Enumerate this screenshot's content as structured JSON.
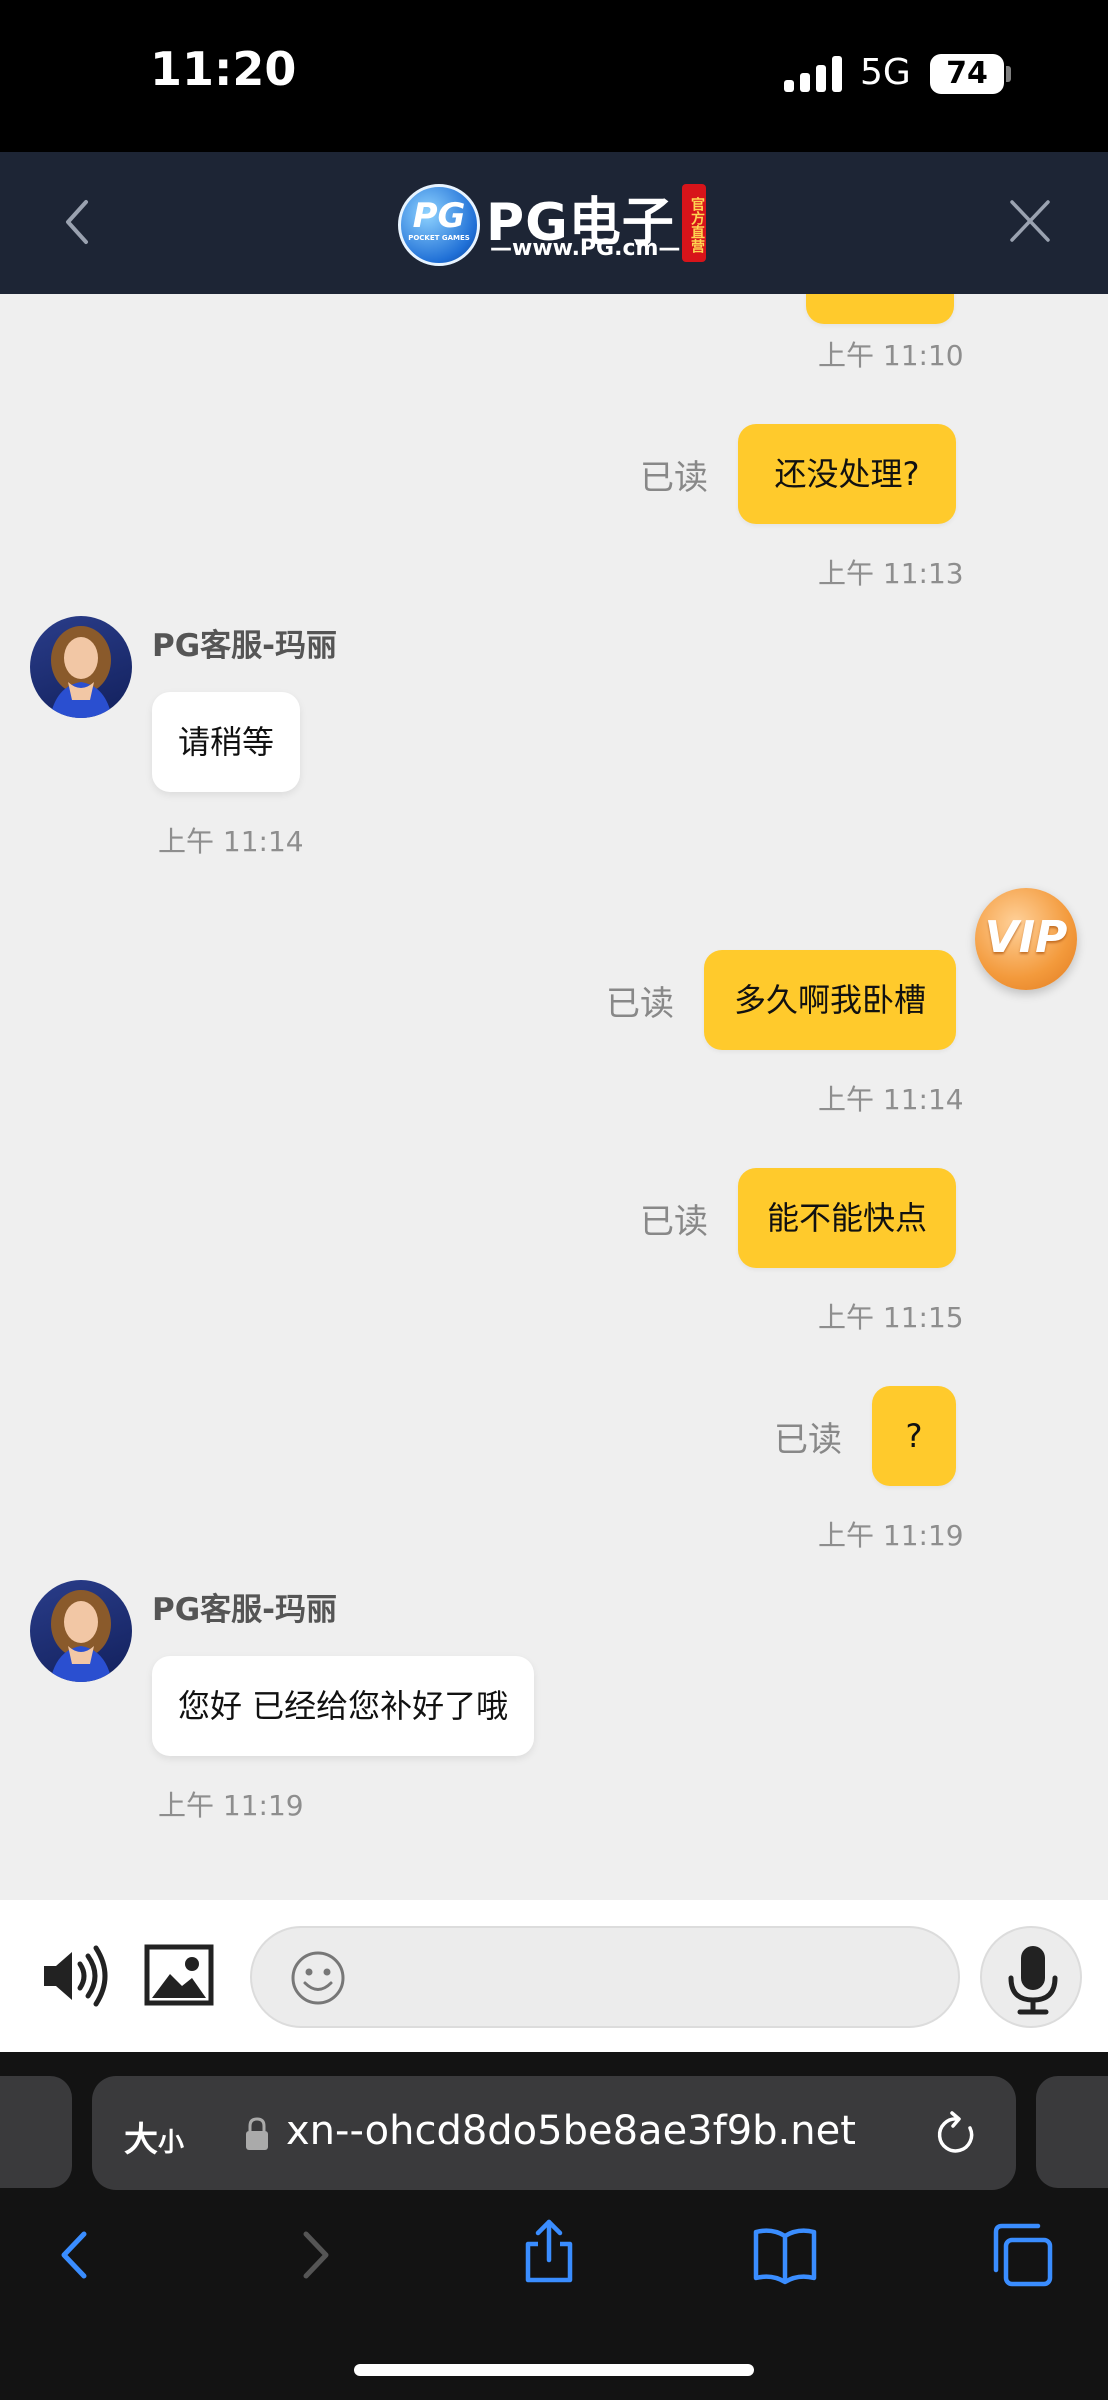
{
  "status_bar": {
    "time": "11:20",
    "network": "5G",
    "battery": "74"
  },
  "header": {
    "logo_mark": "PG",
    "logo_mark_sub": "POCKET GAMES",
    "logo_title": "PG电子",
    "logo_url": "—www.PG.cm—",
    "logo_badge": "官方直营",
    "back_icon": "chevron-left-icon",
    "close_icon": "close-icon"
  },
  "messages": [
    {
      "type": "time",
      "text": "上午 11:10"
    },
    {
      "type": "out",
      "text": "还没处理?",
      "status": "已读"
    },
    {
      "type": "time",
      "text": "上午 11:13"
    },
    {
      "type": "in",
      "sender": "PG客服-玛丽",
      "text": "请稍等"
    },
    {
      "type": "time",
      "text": "上午 11:14"
    },
    {
      "type": "out",
      "text": "多久啊我卧槽",
      "status": "已读"
    },
    {
      "type": "time",
      "text": "上午 11:14"
    },
    {
      "type": "out",
      "text": "能不能快点",
      "status": "已读"
    },
    {
      "type": "time",
      "text": "上午 11:15"
    },
    {
      "type": "out",
      "text": "?",
      "status": "已读"
    },
    {
      "type": "time",
      "text": "上午 11:19"
    },
    {
      "type": "in",
      "sender": "PG客服-玛丽",
      "text": "您好 已经给您补好了哦"
    },
    {
      "type": "time",
      "text": "上午 11:19"
    }
  ],
  "vip_badge": "VIP",
  "input_bar": {
    "speaker_icon": "speaker-icon",
    "image_icon": "image-icon",
    "emoji_icon": "emoji-icon",
    "mic_icon": "microphone-icon"
  },
  "browser": {
    "text_size_big": "大",
    "text_size_small": "小",
    "url": "xn--ohcd8do5be8ae3f9b.net",
    "toolbar_icons": [
      "back-icon",
      "forward-icon",
      "share-icon",
      "bookmarks-icon",
      "tabs-icon"
    ]
  },
  "colors": {
    "header_bg": "#1d2535",
    "outgoing_bubble": "#ffca2c",
    "incoming_bubble": "#ffffff",
    "chat_bg": "#efefef",
    "accent_blue": "#3a8dff"
  }
}
